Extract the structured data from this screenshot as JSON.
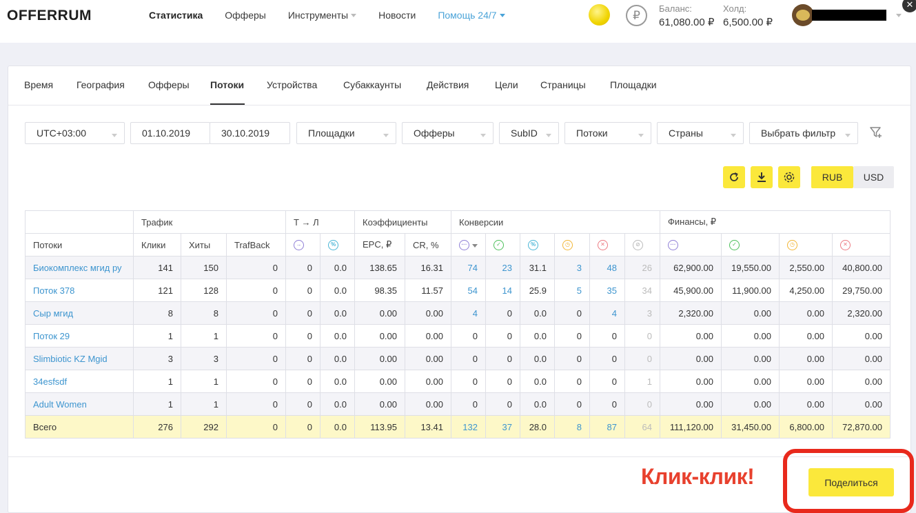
{
  "header": {
    "logo": "OFFERRUM",
    "nav": [
      {
        "label": "Статистика",
        "active": true,
        "dropdown": false
      },
      {
        "label": "Офферы",
        "active": false,
        "dropdown": false
      },
      {
        "label": "Инструменты",
        "active": false,
        "dropdown": true
      },
      {
        "label": "Новости",
        "active": false,
        "dropdown": false
      },
      {
        "label": "Помощь 24/7",
        "active": false,
        "dropdown": true
      }
    ],
    "currency_symbol": "₽",
    "balance_label": "Баланс:",
    "balance_value": "61,080.00 ₽",
    "hold_label": "Холд:",
    "hold_value": "6,500.00 ₽",
    "close_glyph": "✕"
  },
  "tabs": [
    "Время",
    "География",
    "Офферы",
    "Потоки",
    "Устройства",
    "Субаккаунты",
    "Действия",
    "Цели",
    "Страницы",
    "Площадки"
  ],
  "active_tab": "Потоки",
  "filters": {
    "timezone": "UTC+03:00",
    "date_from": "01.10.2019",
    "date_to": "30.10.2019",
    "platforms": "Площадки",
    "offers": "Офферы",
    "subid": "SubID",
    "streams": "Потоки",
    "countries": "Страны",
    "choose_filter": "Выбрать фильтр"
  },
  "currency": {
    "rub": "RUB",
    "usd": "USD",
    "selected": "RUB"
  },
  "table": {
    "groups": [
      "Трафик",
      "Т → Л",
      "Коэффициенты",
      "Конверсии",
      "Финансы, ₽"
    ],
    "columns": [
      "Потоки",
      "Клики",
      "Хиты",
      "TrafBack",
      "EPC, ₽",
      "CR, %"
    ],
    "icons": {
      "tl_1": "→",
      "tl_2": "%",
      "conv_1": "···",
      "conv_2": "✓",
      "conv_3": "%",
      "conv_4": "◷",
      "conv_5": "✕",
      "conv_6": "⊘",
      "fin_1": "···",
      "fin_2": "✓",
      "fin_3": "◷",
      "fin_4": "✕"
    },
    "rows": [
      [
        "Биокомплекс мгид ру",
        "141",
        "150",
        "0",
        "0",
        "0.0",
        "138.65",
        "16.31",
        "74",
        "23",
        "31.1",
        "3",
        "48",
        "26",
        "62,900.00",
        "19,550.00",
        "2,550.00",
        "40,800.00"
      ],
      [
        "Поток 378",
        "121",
        "128",
        "0",
        "0",
        "0.0",
        "98.35",
        "11.57",
        "54",
        "14",
        "25.9",
        "5",
        "35",
        "34",
        "45,900.00",
        "11,900.00",
        "4,250.00",
        "29,750.00"
      ],
      [
        "Сыр мгид",
        "8",
        "8",
        "0",
        "0",
        "0.0",
        "0.00",
        "0.00",
        "4",
        "0",
        "0.0",
        "0",
        "4",
        "3",
        "2,320.00",
        "0.00",
        "0.00",
        "2,320.00"
      ],
      [
        "Поток 29",
        "1",
        "1",
        "0",
        "0",
        "0.0",
        "0.00",
        "0.00",
        "0",
        "0",
        "0.0",
        "0",
        "0",
        "0",
        "0.00",
        "0.00",
        "0.00",
        "0.00"
      ],
      [
        "Slimbiotic KZ Mgid",
        "3",
        "3",
        "0",
        "0",
        "0.0",
        "0.00",
        "0.00",
        "0",
        "0",
        "0.0",
        "0",
        "0",
        "0",
        "0.00",
        "0.00",
        "0.00",
        "0.00"
      ],
      [
        "34esfsdf",
        "1",
        "1",
        "0",
        "0",
        "0.0",
        "0.00",
        "0.00",
        "0",
        "0",
        "0.0",
        "0",
        "0",
        "1",
        "0.00",
        "0.00",
        "0.00",
        "0.00"
      ],
      [
        "Adult Women",
        "1",
        "1",
        "0",
        "0",
        "0.0",
        "0.00",
        "0.00",
        "0",
        "0",
        "0.0",
        "0",
        "0",
        "0",
        "0.00",
        "0.00",
        "0.00",
        "0.00"
      ]
    ],
    "total": [
      "Всего",
      "276",
      "292",
      "0",
      "0",
      "0.0",
      "113.95",
      "13.41",
      "132",
      "37",
      "28.0",
      "8",
      "87",
      "64",
      "111,120.00",
      "31,450.00",
      "6,800.00",
      "72,870.00"
    ]
  },
  "share_button": "Поделиться",
  "annotation_text": "Клик-клик!",
  "colors": {
    "accent": "#fbe83b",
    "link": "#3d95cf",
    "annotation": "#e8412e"
  }
}
